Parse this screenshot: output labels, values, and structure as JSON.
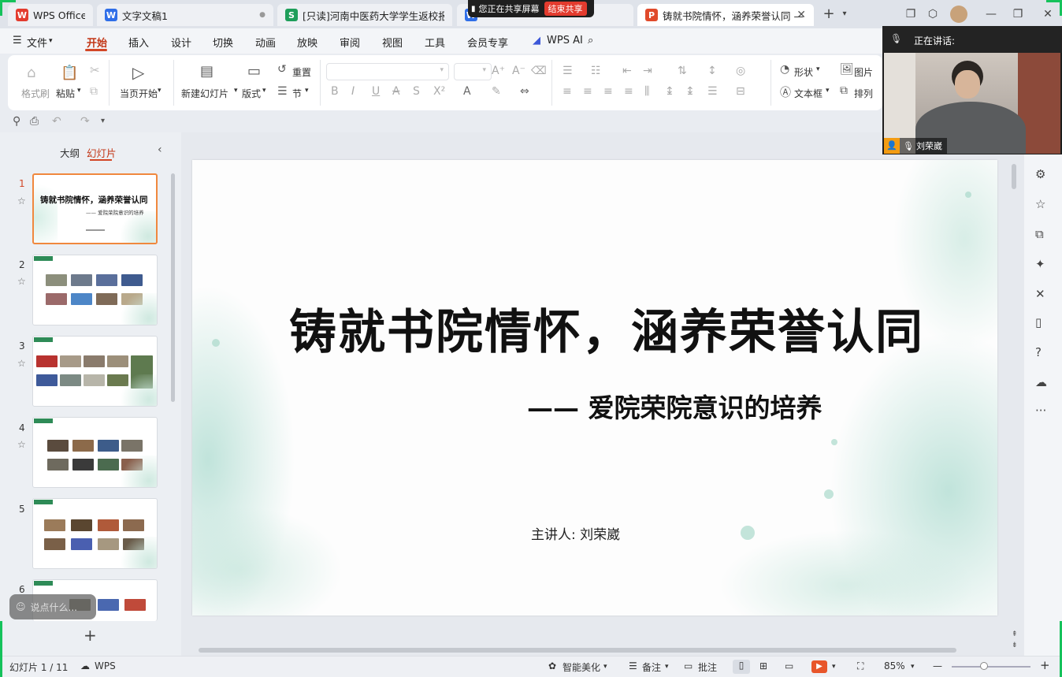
{
  "tabs": [
    {
      "label": "WPS Office",
      "logo": "W",
      "color": "#e33b2e"
    },
    {
      "label": "文字文稿1",
      "logo": "W",
      "color": "#2f6ee8"
    },
    {
      "label": "[只读]河南中医药大学学生返校报到信",
      "logo": "S",
      "color": "#1e9e5a"
    },
    {
      "label": "铸就书院情怀，涵养荣誉认同 —",
      "logo": "P",
      "color": "#e04a2b"
    }
  ],
  "share_banner": {
    "status": "您正在共享屏幕",
    "stop": "结束共享"
  },
  "menu": {
    "file": "文件",
    "items": [
      "开始",
      "插入",
      "设计",
      "切换",
      "动画",
      "放映",
      "审阅",
      "视图",
      "工具",
      "会员专享"
    ],
    "ai": "WPS AI"
  },
  "ribbon": {
    "format_painter": "格式刷",
    "paste": "粘贴",
    "play_current": "当页开始",
    "new_slide": "新建幻灯片",
    "layout": "版式",
    "reset": "重置",
    "section": "节",
    "shape": "形状",
    "picture": "图片",
    "textbox": "文本框",
    "arrange": "排列"
  },
  "left_panel": {
    "outline_tab": "大纲",
    "slides_tab": "幻灯片",
    "thumb1_title": "铸就书院情怀，涵养荣誉认同",
    "thumb1_sub": "—— 爱院荣院意识的培养",
    "slide_numbers": [
      "1",
      "2",
      "3",
      "4",
      "5",
      "6"
    ],
    "comment_placeholder": "说点什么..."
  },
  "slide": {
    "title": "铸就书院情怀，涵养荣誉认同",
    "subtitle": "—— 爱院荣院意识的培养",
    "speaker": "主讲人:   刘荣崴"
  },
  "video": {
    "speaking_label": "正在讲话:",
    "participant": "刘荣崴"
  },
  "status": {
    "slide_counter": "幻灯片 1 / 11",
    "app": "WPS",
    "beautify": "智能美化",
    "notes": "备注",
    "comments": "批注",
    "zoom": "85%"
  },
  "colors": {
    "accent": "#d24726",
    "share_red": "#e33b2e",
    "teal_deco": "#8fcfbf"
  }
}
